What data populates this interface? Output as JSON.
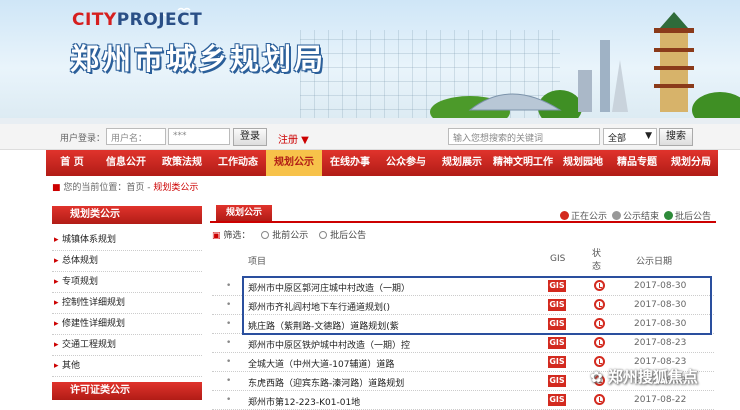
{
  "header": {
    "logo_a": "CITY",
    "logo_b": "PROJECT",
    "site_title": "郑州市城乡规划局"
  },
  "login": {
    "label": "用户登录：",
    "username_value": "用户名：",
    "password_value": "***",
    "login_button": "登录",
    "register_link": "注册 ▼",
    "search_placeholder": "输入您想搜索的关键词",
    "search_scope": "全部",
    "search_button": "搜索"
  },
  "nav": [
    "首 页",
    "信息公开",
    "政策法规",
    "工作动态",
    "规划公示",
    "在线办事",
    "公众参与",
    "规划展示",
    "精神文明工作",
    "规划园地",
    "精品专题",
    "规划分局"
  ],
  "breadcrumb": {
    "prefix": "您的当前位置：首页 - ",
    "current": "规划类公示"
  },
  "sidebar": {
    "head1": "规划类公示",
    "items": [
      "城镇体系规划",
      "总体规划",
      "专项规划",
      "控制性详细规划",
      "修建性详细规划",
      "交通工程规划",
      "其他"
    ],
    "head2": "许可证类公示"
  },
  "main": {
    "tab": "规划公示",
    "legend": [
      "正在公示",
      "公示结束",
      "批后公告"
    ],
    "filter_label": "筛选：",
    "filter_opt1": "批前公示",
    "filter_opt2": "批后公告",
    "columns": [
      "项目",
      "GIS",
      "状态",
      "公示日期"
    ],
    "gis_label": "GIS",
    "rows": [
      {
        "title": "郑州市中原区郭河庄城中村改造（一期）",
        "date": "2017-08-30"
      },
      {
        "title": "郑州市齐礼阎村地下车行通道规划()",
        "date": "2017-08-30"
      },
      {
        "title": "姚庄路（紫荆路-文德路）道路规划(紫",
        "date": "2017-08-30"
      },
      {
        "title": "郑州市中原区铁炉城中村改造（一期）控",
        "date": "2017-08-23"
      },
      {
        "title": "全城大道（中州大道-107辅道）道路",
        "date": "2017-08-23"
      },
      {
        "title": "东虎西路（迎宾东路-溱河路）道路规划",
        "date": "2017-08-23"
      },
      {
        "title": "郑州市第12-223-K01-01地",
        "date": "2017-08-22"
      }
    ]
  },
  "watermark": "郑州搜狐焦点",
  "colors": {
    "nav_red": "#c41f19",
    "active_tab": "#f7c24a",
    "highlight_blue": "#2a4f9e"
  }
}
